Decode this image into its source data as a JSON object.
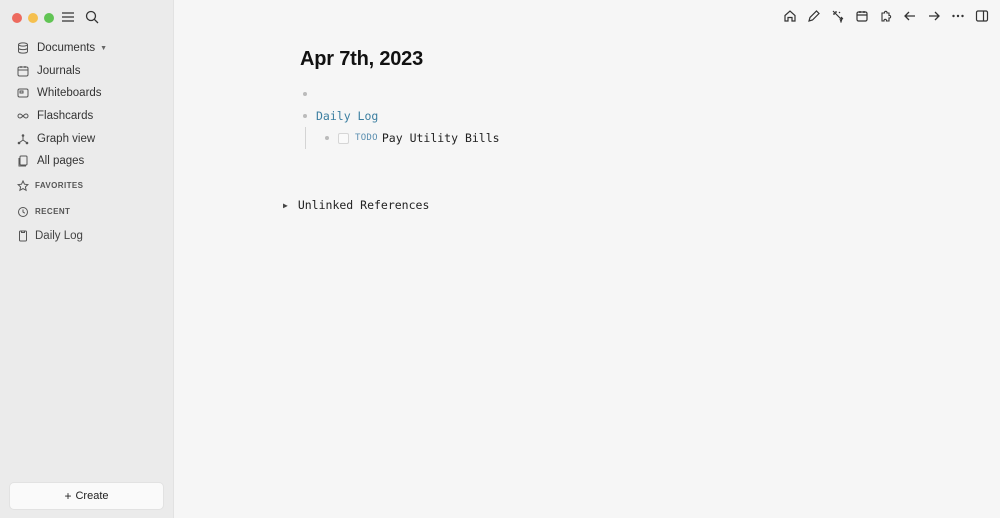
{
  "sidebar": {
    "nav": [
      {
        "label": "Documents",
        "icon": "database-icon"
      },
      {
        "label": "Journals",
        "icon": "calendar-icon"
      },
      {
        "label": "Whiteboards",
        "icon": "whiteboard-icon"
      },
      {
        "label": "Flashcards",
        "icon": "infinity-icon"
      },
      {
        "label": "Graph view",
        "icon": "graph-icon"
      },
      {
        "label": "All pages",
        "icon": "pages-icon"
      }
    ],
    "favorites_label": "FAVORITES",
    "recent_label": "RECENT",
    "recent": [
      {
        "label": "Daily Log"
      }
    ],
    "create_label": "Create"
  },
  "toolbar": {
    "icons": [
      "home-icon",
      "pencil-icon",
      "magic-icon",
      "calendar-icon",
      "puzzle-icon",
      "back-arrow-icon",
      "forward-arrow-icon",
      "more-icon",
      "sidebar-toggle-icon"
    ]
  },
  "page": {
    "title": "Apr 7th, 2023",
    "link_block": "Daily Log",
    "todo_marker": "TODO",
    "todo_text": "Pay Utility Bills",
    "unlinked_label": "Unlinked References"
  },
  "colors": {
    "link": "#3b7ea0",
    "todo": "#5b8fb0",
    "sidebar_bg": "#ebebeb",
    "main_bg": "#f6f6f6"
  }
}
